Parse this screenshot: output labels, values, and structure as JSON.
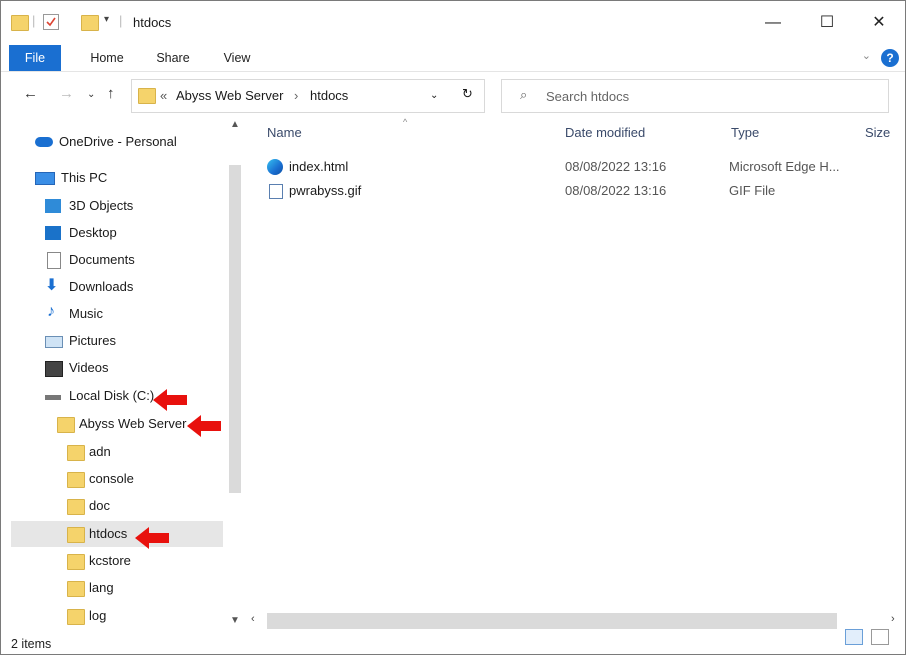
{
  "window": {
    "title": "htdocs",
    "controls": {
      "minimize": "—",
      "maximize": "☐",
      "close": "✕"
    }
  },
  "ribbon": {
    "tabs": [
      "File",
      "Home",
      "Share",
      "View"
    ],
    "help": "?"
  },
  "address": {
    "overflow": "«",
    "crumbs": [
      "Abyss Web Server",
      "htdocs"
    ],
    "separator": "›"
  },
  "search": {
    "placeholder": "Search htdocs"
  },
  "nav": {
    "items": [
      {
        "label": "OneDrive - Personal",
        "icon": "onedrive-icon"
      },
      {
        "label": "This PC",
        "icon": "pc-icon"
      },
      {
        "label": "3D Objects",
        "icon": "3d-objects-icon"
      },
      {
        "label": "Desktop",
        "icon": "desktop-icon"
      },
      {
        "label": "Documents",
        "icon": "documents-icon"
      },
      {
        "label": "Downloads",
        "icon": "downloads-icon"
      },
      {
        "label": "Music",
        "icon": "music-icon"
      },
      {
        "label": "Pictures",
        "icon": "pictures-icon"
      },
      {
        "label": "Videos",
        "icon": "videos-icon"
      },
      {
        "label": "Local Disk (C:)",
        "icon": "drive-icon"
      },
      {
        "label": "Abyss Web Server",
        "icon": "folder-icon"
      },
      {
        "label": "adn",
        "icon": "folder-icon"
      },
      {
        "label": "console",
        "icon": "folder-icon"
      },
      {
        "label": "doc",
        "icon": "folder-icon"
      },
      {
        "label": "htdocs",
        "icon": "folder-icon"
      },
      {
        "label": "kcstore",
        "icon": "folder-icon"
      },
      {
        "label": "lang",
        "icon": "folder-icon"
      },
      {
        "label": "log",
        "icon": "folder-icon"
      }
    ],
    "selected": "htdocs"
  },
  "columns": [
    "Name",
    "Date modified",
    "Type",
    "Size"
  ],
  "files": [
    {
      "name": "index.html",
      "date": "08/08/2022 13:16",
      "type": "Microsoft Edge H...",
      "icon": "edge-icon"
    },
    {
      "name": "pwrabyss.gif",
      "date": "08/08/2022 13:16",
      "type": "GIF File",
      "icon": "image-file-icon"
    }
  ],
  "status": {
    "count": "2 items"
  },
  "colors": {
    "accent": "#1a6fd1",
    "folder": "#f5d36b",
    "arrow": "#e8110d",
    "selected": "#e6e6e6"
  }
}
